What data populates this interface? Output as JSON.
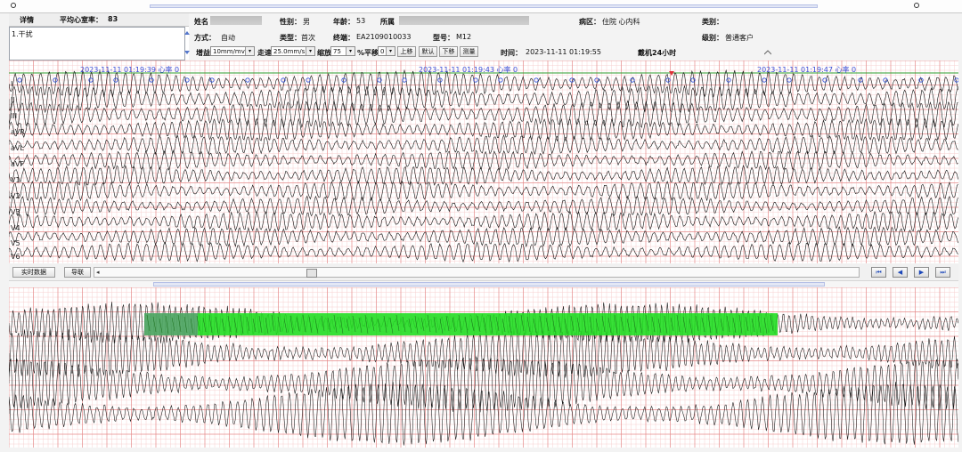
{
  "header": {
    "detail_label": "详情",
    "avg_hr_label": "平均心室率：",
    "avg_hr_value": "83",
    "note": "1.干扰"
  },
  "patient": {
    "name_label": "姓名",
    "gender_label": "性别：",
    "gender": "男",
    "age_label": "年龄：",
    "age": "53",
    "hospital_label": "所属",
    "ward_label": "病区：",
    "ward": "住院 心内科",
    "category_label": "类别：",
    "category": "",
    "mode_label": "方式：",
    "mode": "自动",
    "type_label": "类型：",
    "type": "首次",
    "terminal_label": "终端：",
    "terminal": "EA2109010033",
    "model_label": "型号：",
    "model": "M12",
    "level_label": "级别：",
    "level": "普通客户"
  },
  "controls": {
    "gain_label": "增益",
    "gain_value": "10mm/mv",
    "speed_label": "走速",
    "speed_value": "25.0mm/s",
    "zoom_label": "缩放",
    "zoom_value": "75",
    "pan_label": "%平移",
    "pan_value": "0",
    "up_label": "上移",
    "default_label": "默认",
    "down_label": "下移",
    "measure_label": "测量",
    "time_label": "时间：",
    "time_value": "2023-11-11 01:19:55",
    "wear_label": "戴机24小时"
  },
  "timestamps": [
    "2023-11-11 01:19:39 心率 0",
    "2023-11-11 01:19:43 心率 0",
    "2023-11-11 01:19:47 心率 0"
  ],
  "leads": [
    "I",
    "II",
    "III",
    "aVR",
    "aVL",
    "aVF",
    "V1",
    "V2",
    "V3",
    "V4",
    "V5",
    "V6"
  ],
  "toolbar": {
    "realtime_label": "实时数据",
    "lead_label": "导联"
  },
  "nav_icons": [
    "first-icon",
    "prev-icon",
    "next-icon",
    "last-icon"
  ],
  "colors": {
    "grid_major": "#e68a8a",
    "grid_minor": "#f7d0d0",
    "trace": "#111111",
    "marker": "#2b4bd6",
    "baseline": "#2e9e2e",
    "highlight": "#22dd22",
    "highlight_purple": "#9a4bd0",
    "alert": "#e0303a"
  }
}
